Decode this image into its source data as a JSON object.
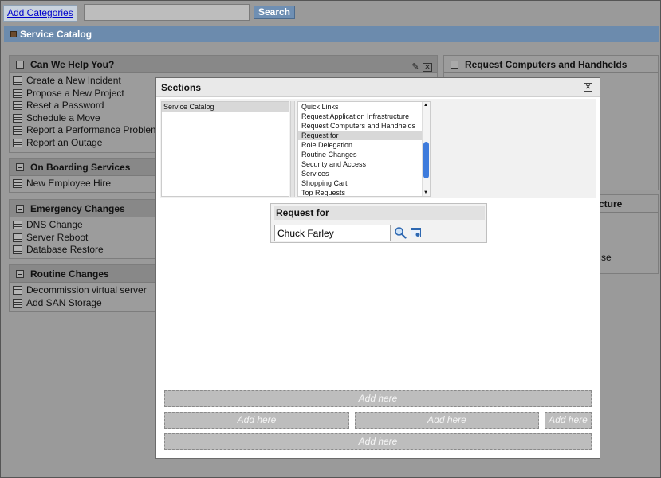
{
  "toolbar": {
    "add_categories": "Add Categories",
    "search_placeholder": "",
    "search_button": "Search"
  },
  "catalog_bar": {
    "title": "Service Catalog"
  },
  "portlets": {
    "help": {
      "title": "Can We Help You?",
      "items": [
        "Create a New Incident",
        "Propose a New Project",
        "Reset a Password",
        "Schedule a Move",
        "Report a Performance Problem",
        "Report an Outage"
      ]
    },
    "onboarding": {
      "title": "On Boarding Services",
      "items": [
        "New Employee Hire"
      ]
    },
    "emergency": {
      "title": "Emergency Changes",
      "items": [
        "DNS Change",
        "Server Reboot",
        "Database Restore"
      ]
    },
    "routine": {
      "title": "Routine Changes",
      "items": [
        "Decommission virtual server",
        "Add SAN Storage"
      ]
    },
    "computers": {
      "title": "Request Computers and Handhelds"
    },
    "partial_right": {
      "title_fragment": "cture",
      "line_fragment": "se"
    }
  },
  "dialog": {
    "title": "Sections",
    "left_list": {
      "selected": "Service Catalog"
    },
    "right_list": {
      "options": [
        "Quick Links",
        "Request Application Infrastructure",
        "Request Computers and Handhelds",
        "Request for",
        "Role Delegation",
        "Routine Changes",
        "Security and Access",
        "Services",
        "Shopping Cart",
        "Top Requests"
      ],
      "selected": "Request for"
    },
    "request_panel": {
      "title": "Request for",
      "value": "Chuck Farley"
    },
    "dropzones": {
      "row1": "Add here",
      "row2_a": "Add here",
      "row2_b": "Add here",
      "row2_c": "Add here",
      "row3": "Add here"
    }
  },
  "colors": {
    "catalog_bar": "#6c8bad",
    "scroll_thumb": "#3e7bdc",
    "link": "#0000cc"
  }
}
